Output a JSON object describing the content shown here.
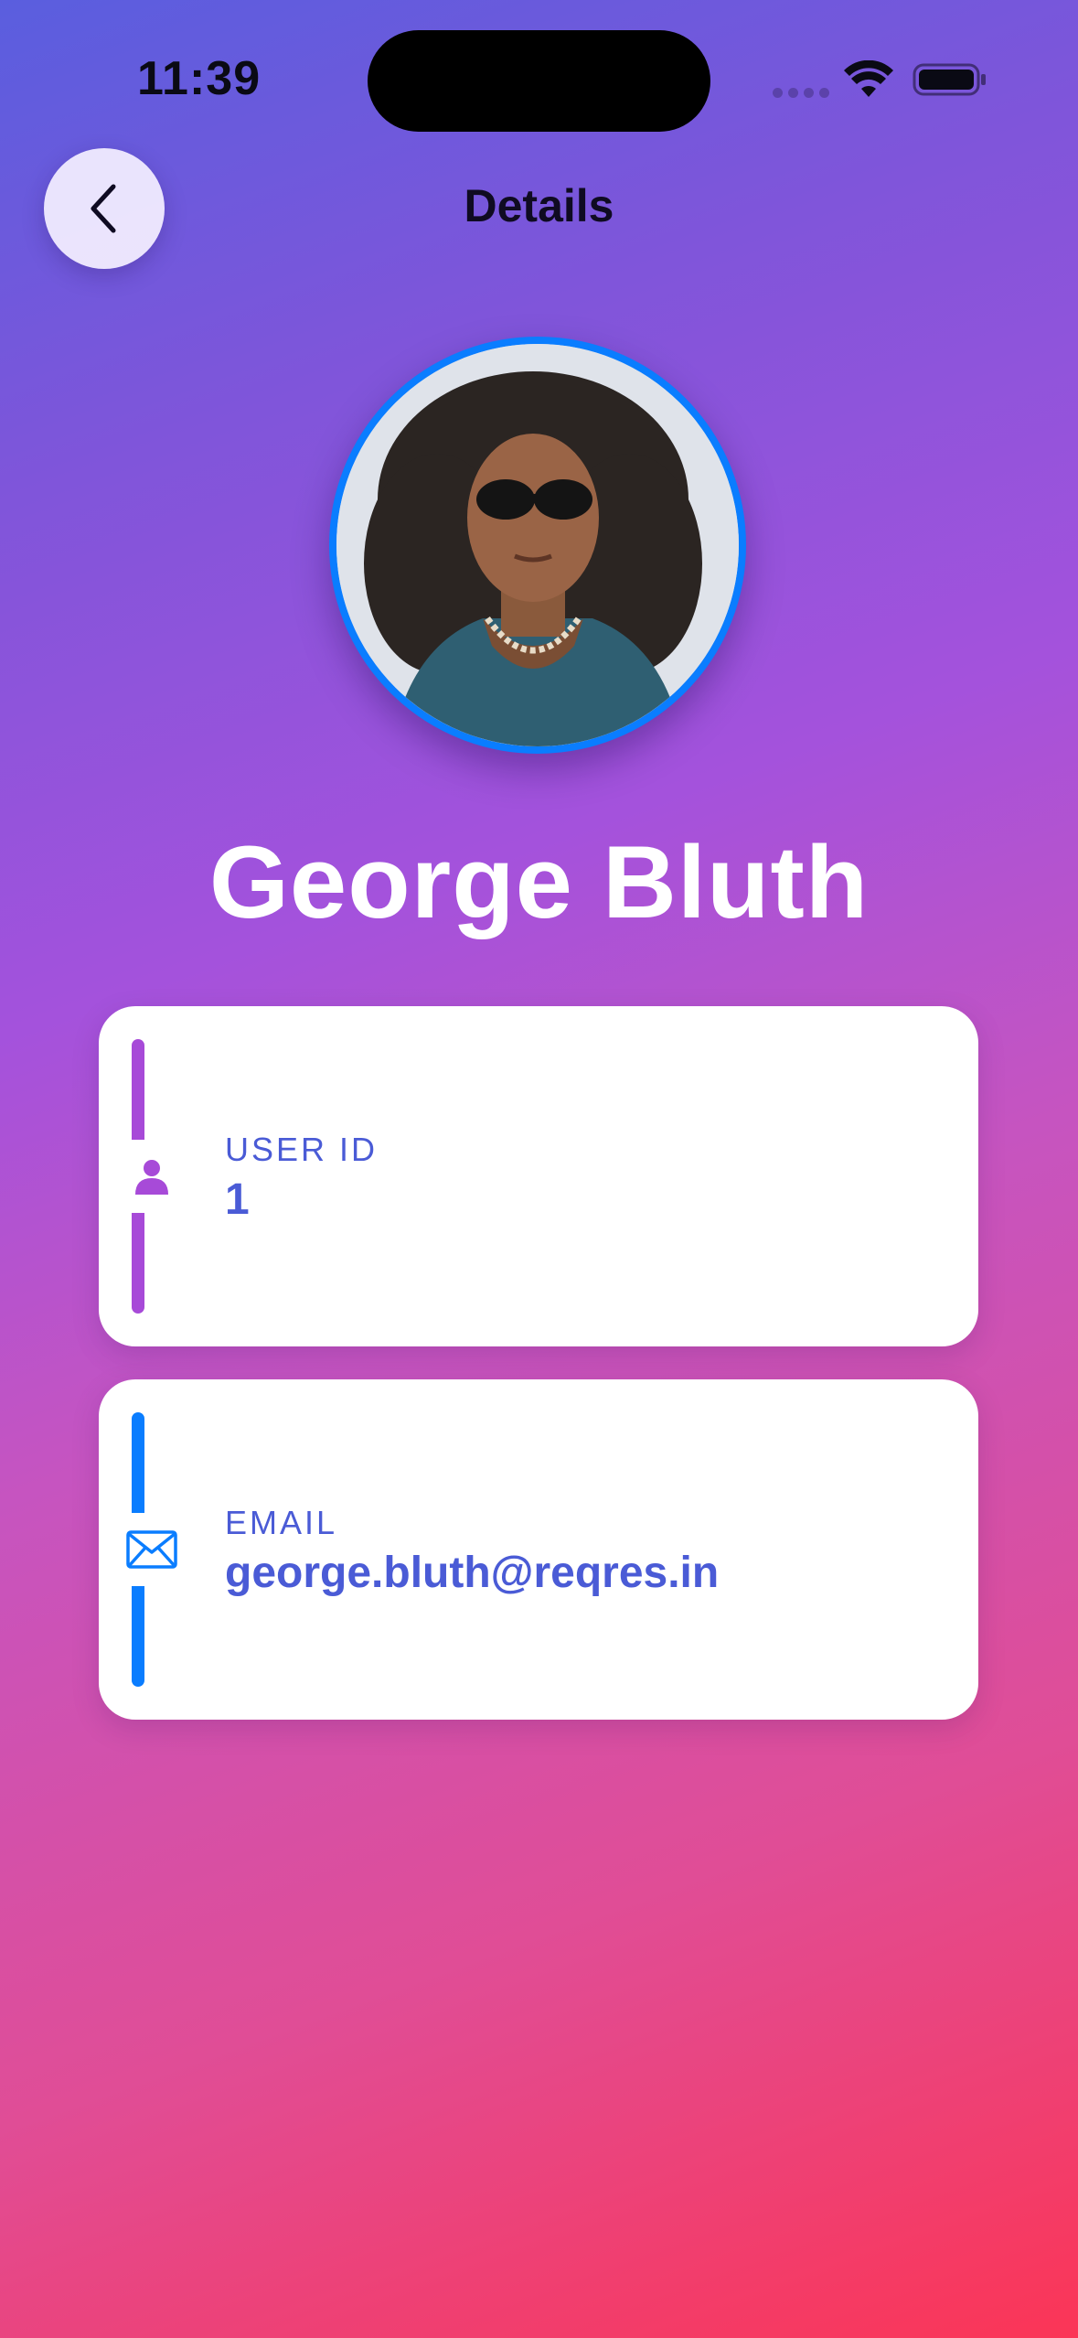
{
  "status_bar": {
    "time": "11:39"
  },
  "nav": {
    "title": "Details",
    "back_icon": "chevron-left-icon"
  },
  "profile": {
    "name": "George Bluth",
    "avatar_border_color": "#0a7dff"
  },
  "cards": [
    {
      "label": "USER ID",
      "value": "1",
      "icon": "person-icon",
      "accent_color": "#a74ad8"
    },
    {
      "label": "EMAIL",
      "value": "george.bluth@reqres.in",
      "icon": "envelope-icon",
      "accent_color": "#0a7dff"
    }
  ],
  "colors": {
    "gradient_top": "#5a5ede",
    "gradient_bottom": "#fb3556",
    "label_text": "#4a5bd6"
  }
}
